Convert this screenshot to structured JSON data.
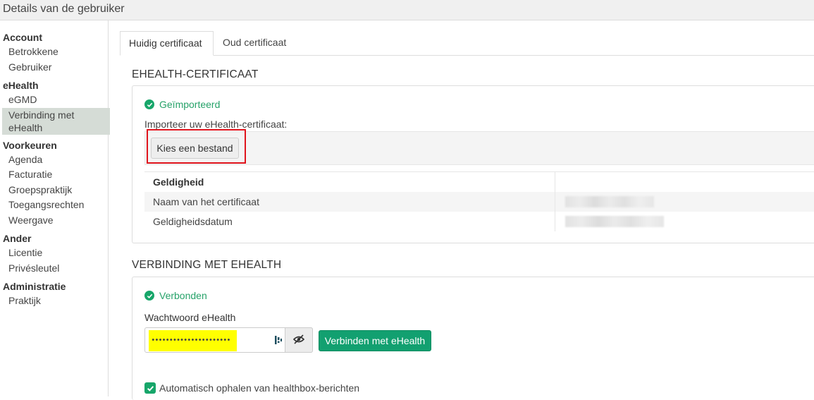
{
  "header": {
    "title": "Details van de gebruiker"
  },
  "sidebar": {
    "groups": [
      {
        "heading": "Account",
        "items": [
          "Betrokkene",
          "Gebruiker"
        ]
      },
      {
        "heading": "eHealth",
        "items": [
          "eGMD",
          "Verbinding met eHealth"
        ]
      },
      {
        "heading": "Voorkeuren",
        "items": [
          "Agenda",
          "Facturatie",
          "Groepspraktijk",
          "Toegangsrechten",
          "Weergave"
        ]
      },
      {
        "heading": "Ander",
        "items": [
          "Licentie",
          "Privésleutel"
        ]
      },
      {
        "heading": "Administratie",
        "items": [
          "Praktijk"
        ]
      }
    ],
    "active_item": "Verbinding met eHealth"
  },
  "tabs": [
    {
      "label": "Huidig certificaat",
      "active": true
    },
    {
      "label": "Oud certificaat",
      "active": false
    }
  ],
  "certificate": {
    "section_title": "EHEALTH-CERTIFICAAT",
    "status": "Geïmporteerd",
    "import_label": "Importeer uw eHealth-certificaat:",
    "choose_file_button": "Kies een bestand",
    "table": {
      "header": "Geldigheid",
      "rows": [
        {
          "label": "Naam van het certificaat",
          "value": ""
        },
        {
          "label": "Geldigheidsdatum",
          "value": ""
        }
      ]
    }
  },
  "connection": {
    "section_title": "VERBINDING MET EHEALTH",
    "status": "Verbonden",
    "password_label": "Wachtwoord eHealth",
    "password_value": "••••••••••••••••••••••",
    "connect_button": "Verbinden met eHealth",
    "auto_fetch_label": "Automatisch ophalen van healthbox-berichten",
    "auto_fetch_checked": true
  },
  "colors": {
    "accent": "#12a070",
    "highlight": "#ffff00",
    "annotation": "#e0141d"
  }
}
